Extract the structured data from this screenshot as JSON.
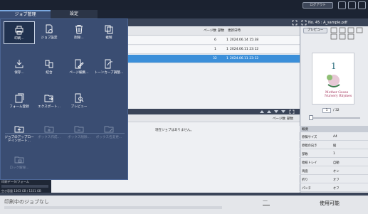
{
  "tabs": {
    "jobs": "ジョブ管理",
    "settings": "設定"
  },
  "topbar": {
    "logout": "ログアウト"
  },
  "job_list": {
    "col_pages": "ページ数",
    "col_copies": "部数",
    "col_updated": "更新日時",
    "rows": [
      {
        "pages": "6",
        "copies": "1",
        "updated": "2024.06.14 15:38"
      },
      {
        "pages": "1",
        "copies": "1",
        "updated": "2024.06.11 23:12"
      },
      {
        "pages": "32",
        "copies": "1",
        "updated": "2024.06.11 23:12"
      }
    ]
  },
  "lower_list": {
    "col_pages": "ページ数",
    "col_copies": "部数",
    "empty": "現在ジョブはありません。"
  },
  "menu": {
    "items": [
      {
        "label": "印刷..."
      },
      {
        "label": "ジョブ設定"
      },
      {
        "label": "削除..."
      },
      {
        "label": "複製"
      },
      {
        "label": "保存..."
      },
      {
        "label": "結合"
      },
      {
        "label": "ページ編集..."
      },
      {
        "label": "トーンカーブ調整..."
      },
      {
        "label": "フォーム登録"
      },
      {
        "label": "エクスポート..."
      },
      {
        "label": "プレビュー"
      },
      {
        "label": "ジョブのアップロー\nドインポート..."
      },
      {
        "label": "ボックス作成..."
      },
      {
        "label": "ボックス削除..."
      },
      {
        "label": "ボックス名変更..."
      },
      {
        "label": "ロック解除..."
      }
    ]
  },
  "storage": {
    "label": "印刷データ/フォーム",
    "text": "空き容量 1303 GB / 1331 GB"
  },
  "right_panel": {
    "doc_title": "No. 45 : A_sample.pdf",
    "preview_button": "プレビュー",
    "page_current": "1",
    "page_total": "/ 32",
    "details_header": "概要",
    "details": [
      {
        "key": "原稿サイズ",
        "value": "A4"
      },
      {
        "key": "原稿の向き",
        "value": "縦"
      },
      {
        "key": "部数",
        "value": "1"
      },
      {
        "key": "給紙トレイ",
        "value": "自動"
      },
      {
        "key": "両面",
        "value": "オン"
      },
      {
        "key": "折り",
        "value": "オフ"
      },
      {
        "key": "パンチ",
        "value": "オフ"
      }
    ]
  },
  "footer": {
    "status": "印刷中のジョブなし",
    "dash": "—",
    "ready": "使用可能"
  }
}
